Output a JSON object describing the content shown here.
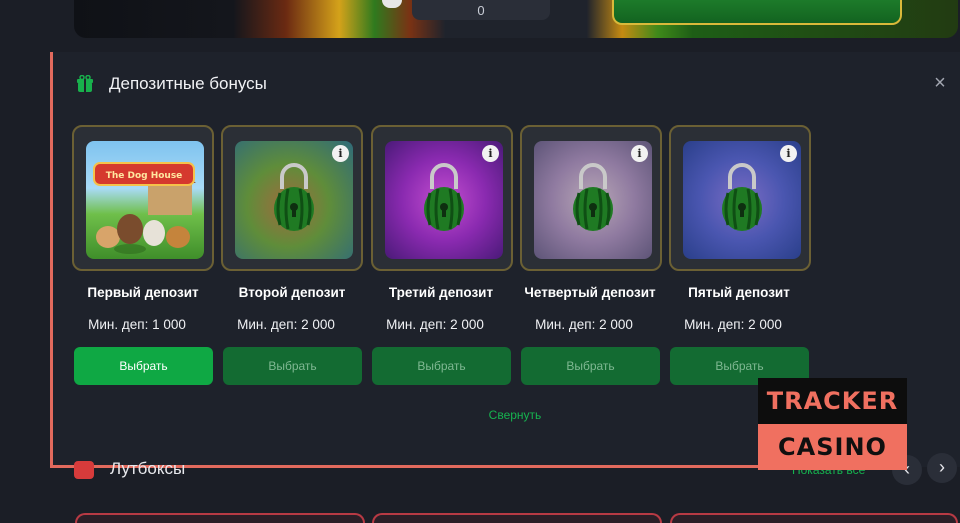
{
  "top_bar": {
    "input_value": "0"
  },
  "panel": {
    "title": "Депозитные бонусы",
    "close_label": "×",
    "collapse_label": "Свернуть"
  },
  "cards": [
    {
      "title": "Первый депозит",
      "min_deposit": "Мин. деп: 1 000",
      "button_label": "Выбрать",
      "state": "active",
      "locked": false,
      "thumb": "dog-house-game",
      "logo_text": "The Dog House",
      "info_badge": ""
    },
    {
      "title": "Второй депозит",
      "min_deposit": "Мин. деп: 2 000",
      "button_label": "Выбрать",
      "state": "disabled",
      "locked": true,
      "thumb": "blurred-game",
      "info_badge": "i"
    },
    {
      "title": "Третий депозит",
      "min_deposit": "Мин. деп: 2 000",
      "button_label": "Выбрать",
      "state": "disabled",
      "locked": true,
      "thumb": "blurred-game",
      "info_badge": "i"
    },
    {
      "title": "Четвертый депозит",
      "min_deposit": "Мин. деп: 2 000",
      "button_label": "Выбрать",
      "state": "disabled",
      "locked": true,
      "thumb": "blurred-game",
      "info_badge": "i"
    },
    {
      "title": "Пятый депозит",
      "min_deposit": "Мин. деп: 2 000",
      "button_label": "Выбрать",
      "state": "disabled",
      "locked": true,
      "thumb": "blurred-game",
      "info_badge": "i"
    }
  ],
  "lootboxes": {
    "title": "Лутбоксы",
    "show_all": "Показать все",
    "prev_icon": "‹",
    "next_icon": "›"
  },
  "watermark": {
    "line1": "TRACKER",
    "line2": "CASINO"
  },
  "colors": {
    "accent_green": "#0fa844",
    "disabled_green": "#136b32",
    "link_green": "#16b34f",
    "highlight": "#e26a5d",
    "card_border": "#6b6034"
  }
}
